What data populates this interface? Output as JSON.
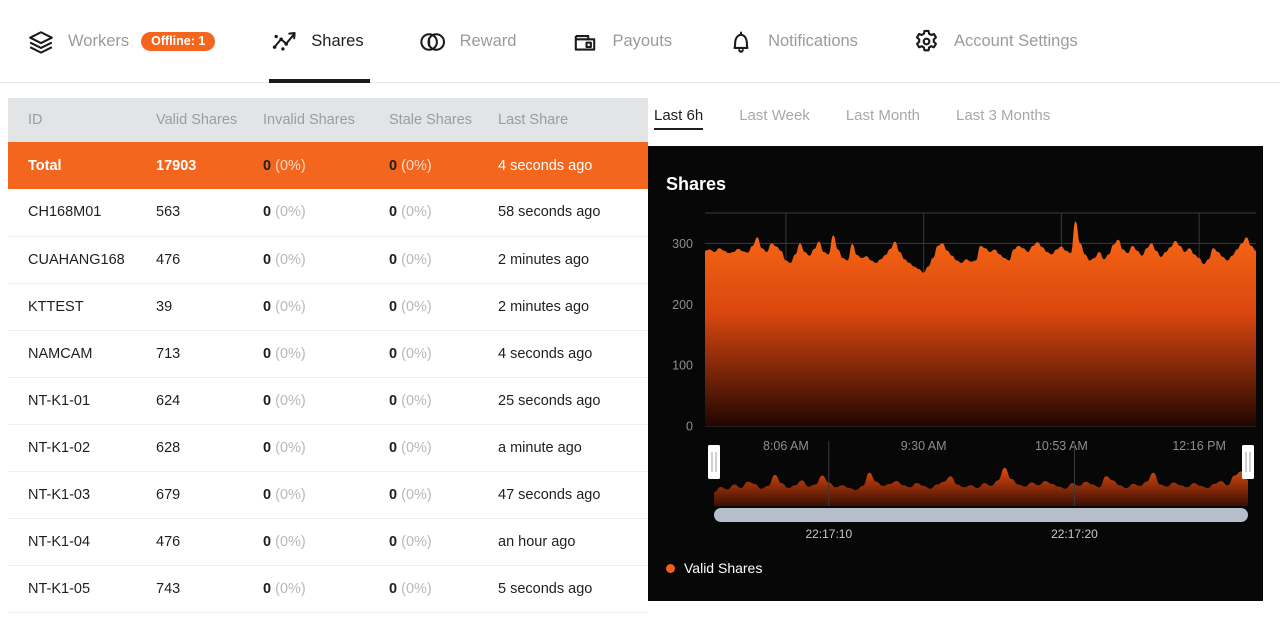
{
  "nav": {
    "items": [
      {
        "label": "Workers",
        "icon": "layers-icon",
        "active": false,
        "badge": "Offline: 1"
      },
      {
        "label": "Shares",
        "icon": "trending-scatter-icon",
        "active": true
      },
      {
        "label": "Reward",
        "icon": "coins-icon",
        "active": false
      },
      {
        "label": "Payouts",
        "icon": "wallet-icon",
        "active": false
      },
      {
        "label": "Notifications",
        "icon": "bell-icon",
        "active": false
      },
      {
        "label": "Account Settings",
        "icon": "gear-icon",
        "active": false
      }
    ]
  },
  "table": {
    "columns": [
      "ID",
      "Valid Shares",
      "Invalid Shares",
      "Stale Shares",
      "Last Share"
    ],
    "total_row": {
      "id": "Total",
      "valid": "17903",
      "invalid": "0",
      "invalid_pct": "(0%)",
      "stale": "0",
      "stale_pct": "(0%)",
      "last_share": "4 seconds ago"
    },
    "rows": [
      {
        "id": "CH168M01",
        "valid": "563",
        "invalid": "0",
        "invalid_pct": "(0%)",
        "stale": "0",
        "stale_pct": "(0%)",
        "last_share": "58 seconds ago"
      },
      {
        "id": "CUAHANG168",
        "valid": "476",
        "invalid": "0",
        "invalid_pct": "(0%)",
        "stale": "0",
        "stale_pct": "(0%)",
        "last_share": "2 minutes ago"
      },
      {
        "id": "KTTEST",
        "valid": "39",
        "invalid": "0",
        "invalid_pct": "(0%)",
        "stale": "0",
        "stale_pct": "(0%)",
        "last_share": "2 minutes ago"
      },
      {
        "id": "NAMCAM",
        "valid": "713",
        "invalid": "0",
        "invalid_pct": "(0%)",
        "stale": "0",
        "stale_pct": "(0%)",
        "last_share": "4 seconds ago"
      },
      {
        "id": "NT-K1-01",
        "valid": "624",
        "invalid": "0",
        "invalid_pct": "(0%)",
        "stale": "0",
        "stale_pct": "(0%)",
        "last_share": "25 seconds ago"
      },
      {
        "id": "NT-K1-02",
        "valid": "628",
        "invalid": "0",
        "invalid_pct": "(0%)",
        "stale": "0",
        "stale_pct": "(0%)",
        "last_share": "a minute ago"
      },
      {
        "id": "NT-K1-03",
        "valid": "679",
        "invalid": "0",
        "invalid_pct": "(0%)",
        "stale": "0",
        "stale_pct": "(0%)",
        "last_share": "47 seconds ago"
      },
      {
        "id": "NT-K1-04",
        "valid": "476",
        "invalid": "0",
        "invalid_pct": "(0%)",
        "stale": "0",
        "stale_pct": "(0%)",
        "last_share": "an hour ago"
      },
      {
        "id": "NT-K1-05",
        "valid": "743",
        "invalid": "0",
        "invalid_pct": "(0%)",
        "stale": "0",
        "stale_pct": "(0%)",
        "last_share": "5 seconds ago"
      }
    ]
  },
  "range_tabs": [
    {
      "label": "Last 6h",
      "active": true
    },
    {
      "label": "Last Week",
      "active": false
    },
    {
      "label": "Last Month",
      "active": false
    },
    {
      "label": "Last 3 Months",
      "active": false
    }
  ],
  "chart_data": {
    "type": "area",
    "title": "Shares",
    "xlabel": "",
    "ylabel": "",
    "ylim": [
      0,
      350
    ],
    "yticks": [
      0,
      100,
      200,
      300
    ],
    "grid": true,
    "legend": [
      {
        "name": "Valid Shares",
        "color": "#f4601c"
      }
    ],
    "legend_position": "bottom-left",
    "xticks": [
      "8:06 AM",
      "9:30 AM",
      "10:53 AM",
      "12:16 PM"
    ],
    "series": [
      {
        "name": "Valid Shares",
        "color": "#f4601c",
        "values": [
          288,
          290,
          286,
          292,
          288,
          284,
          286,
          291,
          287,
          285,
          296,
          310,
          292,
          286,
          300,
          295,
          288,
          272,
          268,
          282,
          300,
          286,
          280,
          291,
          303,
          286,
          282,
          313,
          290,
          276,
          272,
          299,
          281,
          276,
          279,
          272,
          268,
          274,
          281,
          291,
          303,
          286,
          274,
          268,
          262,
          258,
          252,
          262,
          276,
          296,
          300,
          288,
          280,
          272,
          268,
          274,
          270,
          272,
          296,
          292,
          286,
          290,
          282,
          276,
          272,
          290,
          296,
          292,
          286,
          296,
          302,
          294,
          286,
          282,
          290,
          295,
          288,
          284,
          336,
          300,
          282,
          272,
          276,
          286,
          274,
          282,
          298,
          306,
          290,
          284,
          296,
          288,
          280,
          292,
          300,
          288,
          278,
          286,
          294,
          304,
          296,
          286,
          292,
          282,
          276,
          266,
          274,
          292,
          286,
          278,
          272,
          280,
          290,
          300,
          310,
          296,
          288
        ]
      }
    ],
    "brush": {
      "ticks": [
        "22:17:10",
        "22:17:20"
      ],
      "selection": "full",
      "values": [
        40,
        55,
        48,
        62,
        52,
        70,
        64,
        50,
        58,
        90,
        66,
        52,
        60,
        74,
        56,
        62,
        88,
        68,
        54,
        60,
        52,
        46,
        58,
        96,
        70,
        58,
        64,
        72,
        60,
        54,
        66,
        58,
        50,
        62,
        70,
        86,
        62,
        54,
        60,
        52,
        66,
        58,
        74,
        110,
        78,
        62,
        56,
        68,
        60,
        72,
        64,
        56,
        50,
        66,
        58,
        70,
        62,
        54,
        86,
        74,
        60,
        52,
        64,
        58,
        70,
        96,
        62,
        56,
        68,
        60,
        54,
        66,
        58,
        52,
        64,
        72,
        60,
        88,
        100,
        76
      ]
    }
  }
}
